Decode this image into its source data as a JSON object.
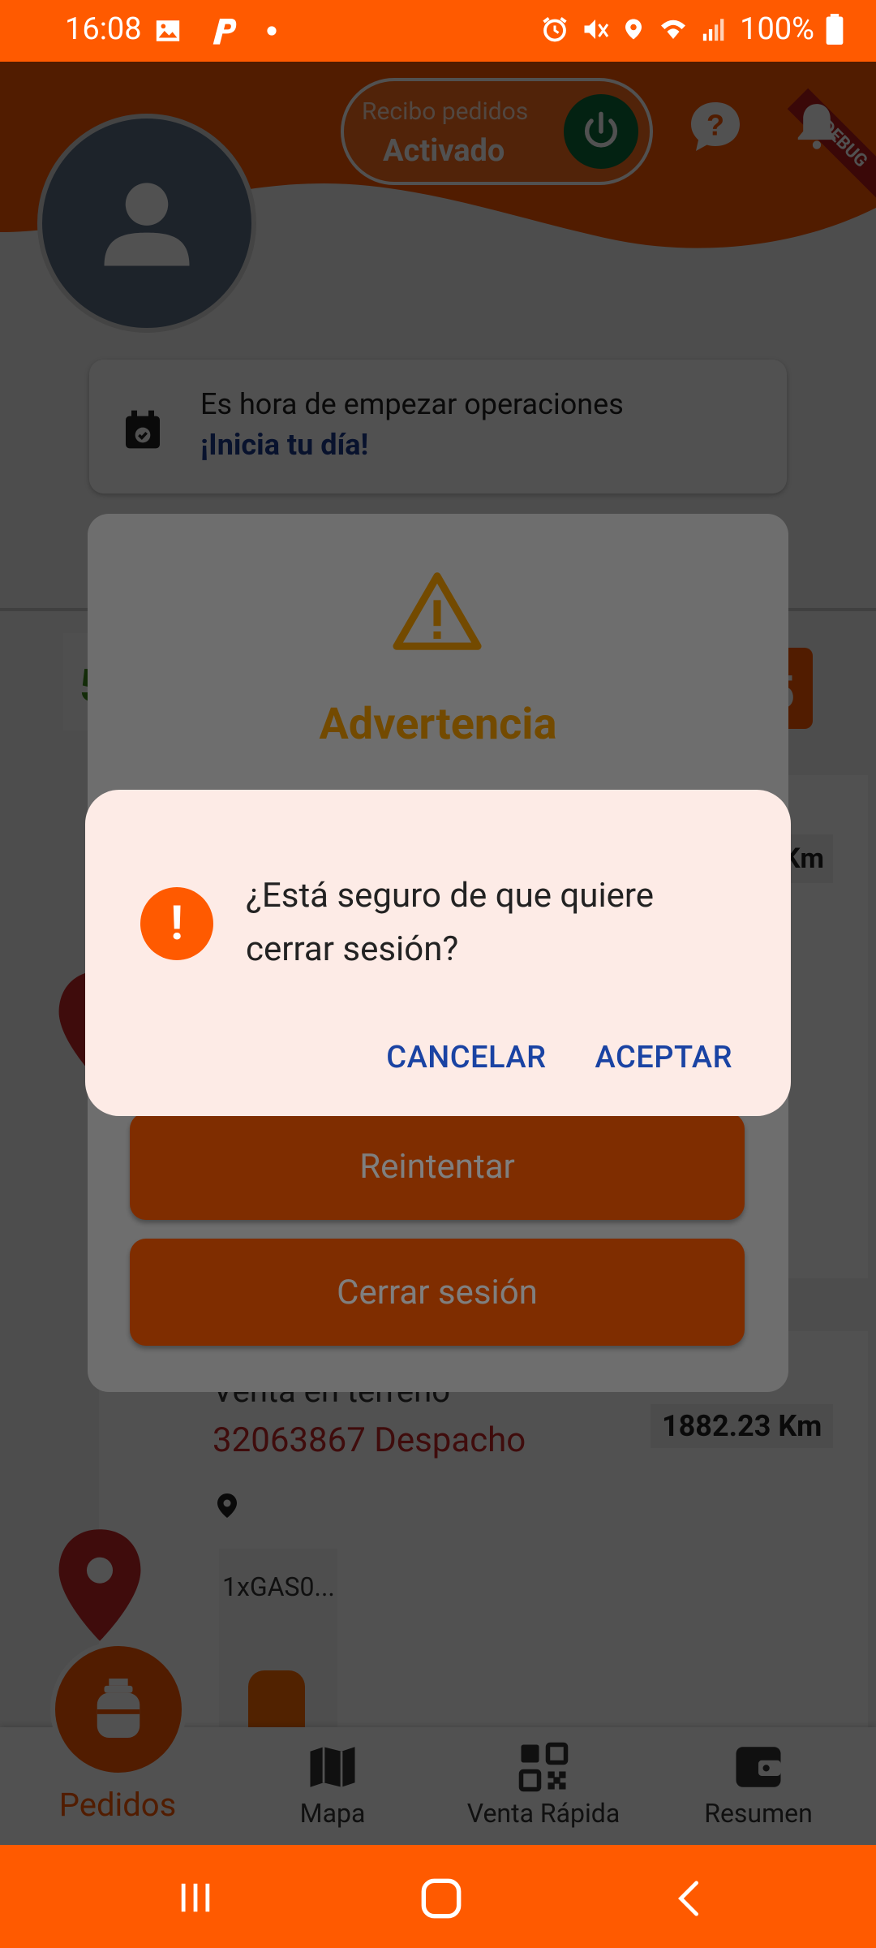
{
  "status_bar": {
    "time": "16:08",
    "battery": "100%"
  },
  "header": {
    "receive_orders_label": "Recibo pedidos",
    "receive_orders_state": "Activado",
    "debug_banner": "DEBUG"
  },
  "ops_card": {
    "line1": "Es hora de empezar operaciones",
    "line2": "¡Inicia tu día!"
  },
  "background_orders": {
    "order2": {
      "type": "Venta en terreno",
      "number": "32063867 Despacho",
      "distance": "1882.23 Km",
      "product": "1xGAS0..."
    },
    "order1_distance_partial": "Km"
  },
  "bottom_nav": {
    "items": [
      {
        "label": "Pedidos",
        "icon": "gas-cylinder-icon"
      },
      {
        "label": "Mapa",
        "icon": "map-icon"
      },
      {
        "label": "Venta Rápida",
        "icon": "qr-code-icon"
      },
      {
        "label": "Resumen",
        "icon": "wallet-icon"
      }
    ]
  },
  "warning_dialog": {
    "title": "Advertencia",
    "retry_label": "Reintentar",
    "logout_label": "Cerrar sesión"
  },
  "confirm_dialog": {
    "message": "¿Está seguro de que quiere cerrar sesión?",
    "cancel_label": "CANCELAR",
    "accept_label": "ACEPTAR"
  },
  "colors": {
    "brand_orange": "#ff5a00",
    "power_green": "#0a6b3b",
    "link_blue": "#1a43a3",
    "warning_amber": "#e69500"
  }
}
